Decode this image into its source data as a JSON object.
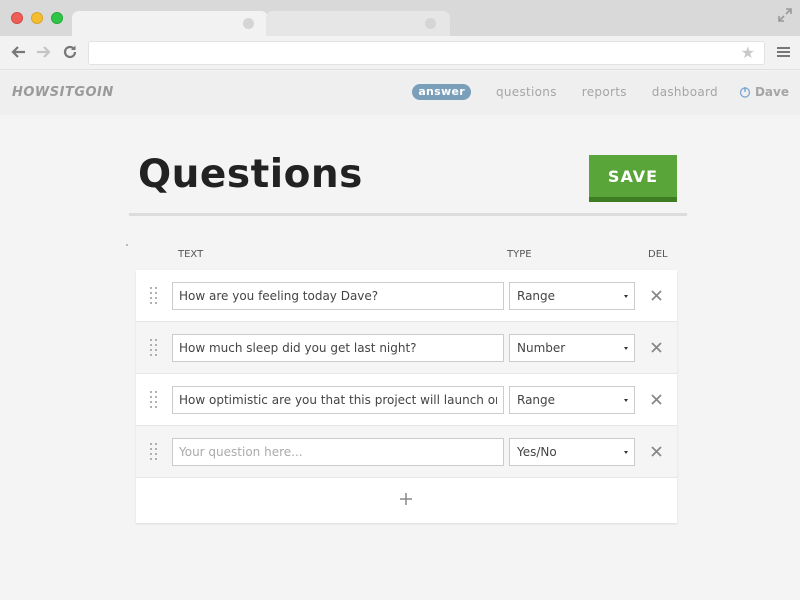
{
  "browser": {
    "address": "",
    "icons": {
      "back": "arrow-left-icon",
      "forward": "arrow-right-icon",
      "reload": "reload-icon",
      "star": "star-icon",
      "menu": "menu-icon",
      "expand": "expand-icon"
    }
  },
  "app": {
    "logo": "HOWSITGOIN",
    "nav": {
      "answer": "answer",
      "questions": "questions",
      "reports": "reports",
      "dashboard": "dashboard",
      "user": "Dave"
    }
  },
  "page": {
    "title": "Questions",
    "save_label": "SAVE",
    "columns": {
      "text": "TEXT",
      "type": "TYPE",
      "del": "DEL"
    },
    "questions": [
      {
        "text": "How are you feeling today Dave?",
        "placeholder": "",
        "type": "Range"
      },
      {
        "text": "How much sleep did you get last night?",
        "placeholder": "",
        "type": "Number"
      },
      {
        "text": "How optimistic are you that this project will launch on ti",
        "placeholder": "",
        "type": "Range"
      },
      {
        "text": "",
        "placeholder": "Your question here...",
        "type": "Yes/No"
      }
    ]
  },
  "colors": {
    "accent_save": "#5aa53a",
    "nav_active_badge": "#7a9fbb"
  }
}
